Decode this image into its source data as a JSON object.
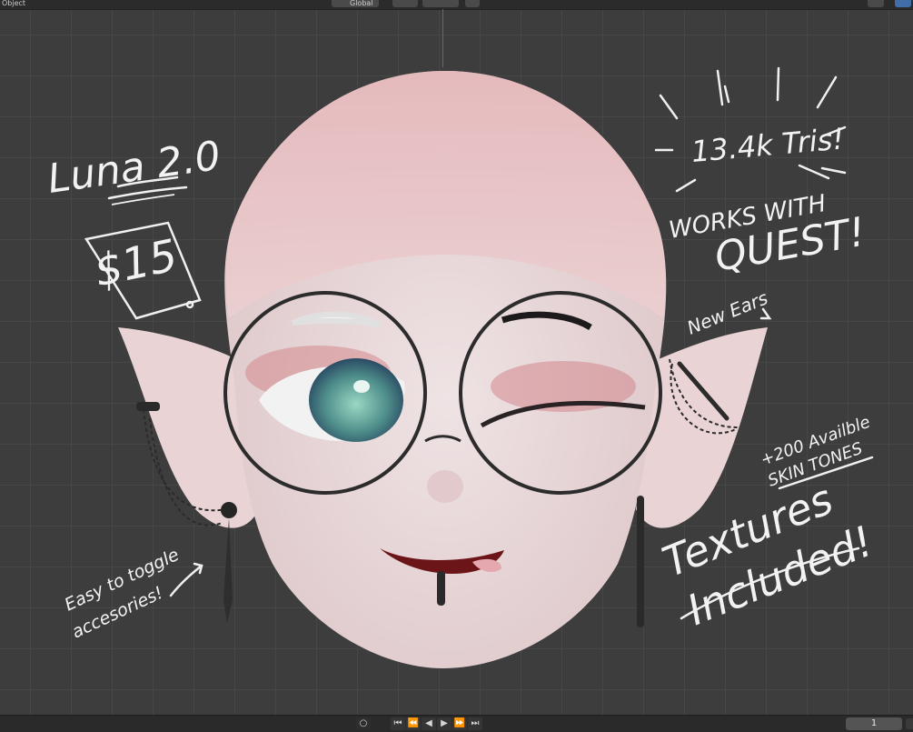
{
  "header": {
    "mode_label": "Object",
    "transform_label": "Global",
    "snap_icon": "magnet-icon",
    "proportional_icon": "circle-icon"
  },
  "annotations": {
    "title": "Luna 2.0",
    "price": "$15",
    "tris": "13.4k Tris!",
    "works_line1": "WORKS WITH",
    "works_line2": "QUEST!",
    "new_ears": "New Ears",
    "skin_line1": "+200 Availble",
    "skin_line2": "SKIN TONES",
    "textures_line1": "Textures",
    "textures_line2": "Included!",
    "toggle_line1": "Easy to toggle",
    "toggle_line2": "accesories!"
  },
  "timeline": {
    "current_frame": "1",
    "buttons": [
      "⏮",
      "⏪",
      "◀",
      "▶",
      "⏩",
      "⏭"
    ]
  },
  "colors": {
    "grid_bg": "#3d3d3d",
    "grid_line": "#474747",
    "skin": "#ead7da",
    "scalp": "#e4b8bb",
    "eye": "#5fa39a",
    "lips": "#6b1518",
    "chalk": "#f2f2f2"
  }
}
